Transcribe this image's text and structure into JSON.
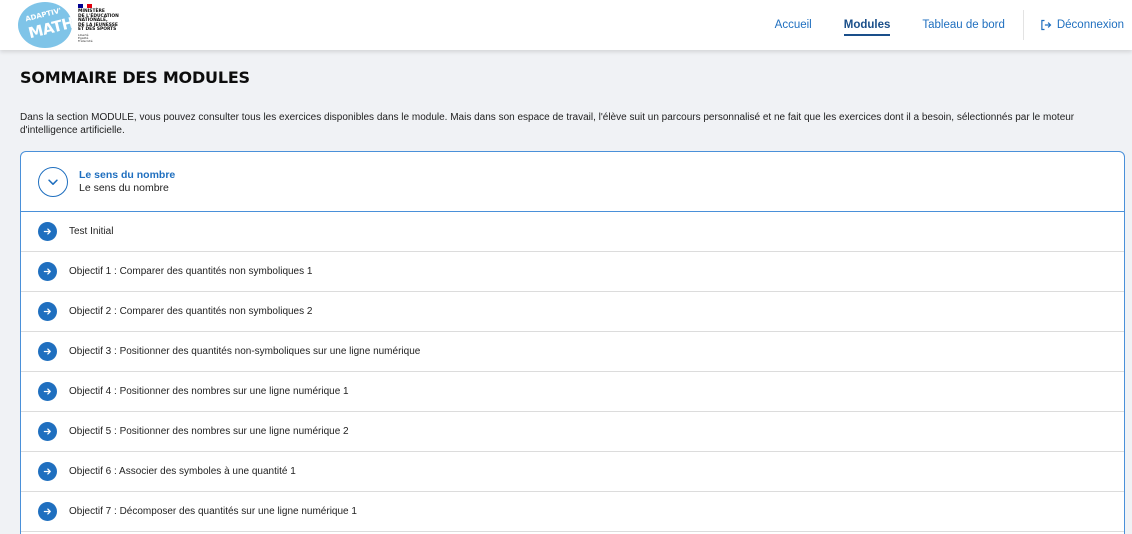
{
  "header": {
    "logo": {
      "small": "ADAPTIV'",
      "big": "MATH"
    },
    "ministry": {
      "text": "MINISTÈRE\nDE L'ÉDUCATION\nNATIONALE,\nDE LA JEUNESSE\nET DES SPORTS",
      "motto": "Liberté\nÉgalité\nFraternité",
      "flag_colors": [
        "#000091",
        "#ffffff",
        "#e1000f"
      ]
    },
    "nav": [
      {
        "label": "Accueil",
        "active": false
      },
      {
        "label": "Modules",
        "active": true
      },
      {
        "label": "Tableau de bord",
        "active": false
      }
    ],
    "logout_label": "Déconnexion"
  },
  "page": {
    "title": "SOMMAIRE DES MODULES",
    "intro": "Dans la section MODULE, vous pouvez consulter tous les exercices disponibles dans le module. Mais dans son espace de travail, l'élève suit un parcours personnalisé et ne fait que les exercices dont il a besoin, sélectionnés par le moteur d'intelligence artificielle."
  },
  "module": {
    "title": "Le sens du nombre",
    "subtitle": "Le sens du nombre",
    "items": [
      {
        "label": "Test Initial"
      },
      {
        "label": "Objectif 1 : Comparer des quantités non symboliques 1"
      },
      {
        "label": "Objectif 2 : Comparer des quantités non symboliques 2"
      },
      {
        "label": "Objectif 3 : Positionner des quantités non-symboliques sur une ligne numérique"
      },
      {
        "label": "Objectif 4 : Positionner des nombres sur une ligne numérique 1"
      },
      {
        "label": "Objectif 5 : Positionner des nombres sur une ligne numérique 2"
      },
      {
        "label": "Objectif 6 : Associer des symboles à une quantité 1"
      },
      {
        "label": "Objectif 7 : Décomposer des quantités sur une ligne numérique 1"
      }
    ]
  },
  "icons": {
    "expand": "chevron-down-icon",
    "item": "arrow-right-icon",
    "logout": "logout-icon"
  },
  "colors": {
    "primary": "#1f6fbf",
    "border": "#4a90d9",
    "logo_bg": "#7fc4e8",
    "background": "#f0f2f5"
  }
}
